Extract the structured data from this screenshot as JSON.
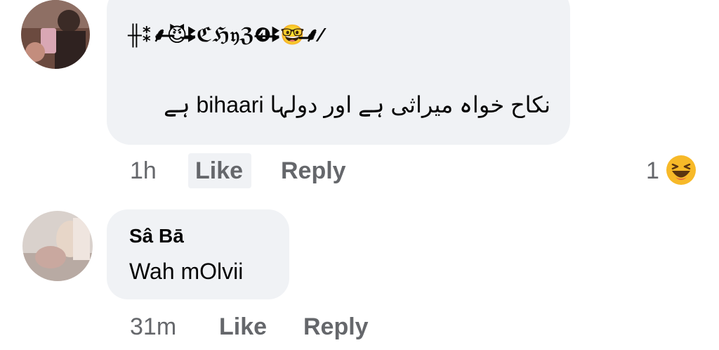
{
  "comments": [
    {
      "author": "╫⁑⸙̶̶̶̶̶̶̶̶̶̶😈̶̶̶̶̶̶̶̶ꔪ̶̶̶̶̶̶̶̶̶̶̶ℭℌ𝔶ℨ❹̶̶̶̶ꔪ̶̶̶̶̶̶🤓̶̶̶̶⸙⁄",
      "text": "نکاح خواہ میراثی ہے اور دولہا bihaari ہے",
      "time": "1h",
      "like_label": "Like",
      "reply_label": "Reply",
      "reaction_count": "1",
      "reaction_icon": "haha-emoji-icon"
    },
    {
      "author": "Sâ Bā",
      "text": "Wah mOlvii",
      "time": "31m",
      "like_label": "Like",
      "reply_label": "Reply"
    }
  ]
}
